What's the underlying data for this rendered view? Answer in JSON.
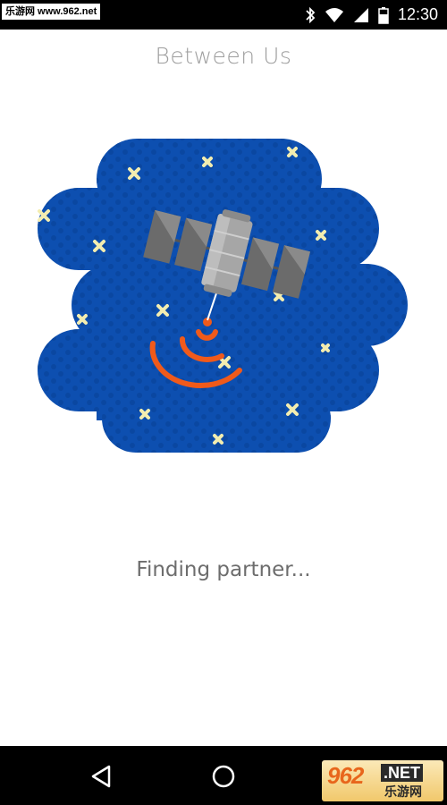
{
  "status_bar": {
    "watermark": "乐游网 www.962.net",
    "time": "12:30",
    "icons": [
      "bluetooth-icon",
      "wifi-icon",
      "signal-icon",
      "battery-icon"
    ]
  },
  "header": {
    "title": "Between Us"
  },
  "illustration": {
    "description_icon": "satellite-icon",
    "colors": {
      "cloud": "#0d4fb0",
      "dots": "#0a449b",
      "stars": "#f3edb0",
      "signal": "#f05a1a",
      "panel": "#6b6b6b",
      "body": "#9a9a9a"
    }
  },
  "status": {
    "message": "Finding partner..."
  },
  "nav_bar": {
    "icons": [
      "back-icon",
      "home-icon"
    ],
    "watermark_number": "962",
    "watermark_suffix": ".NET",
    "watermark_cn": "乐游网"
  }
}
